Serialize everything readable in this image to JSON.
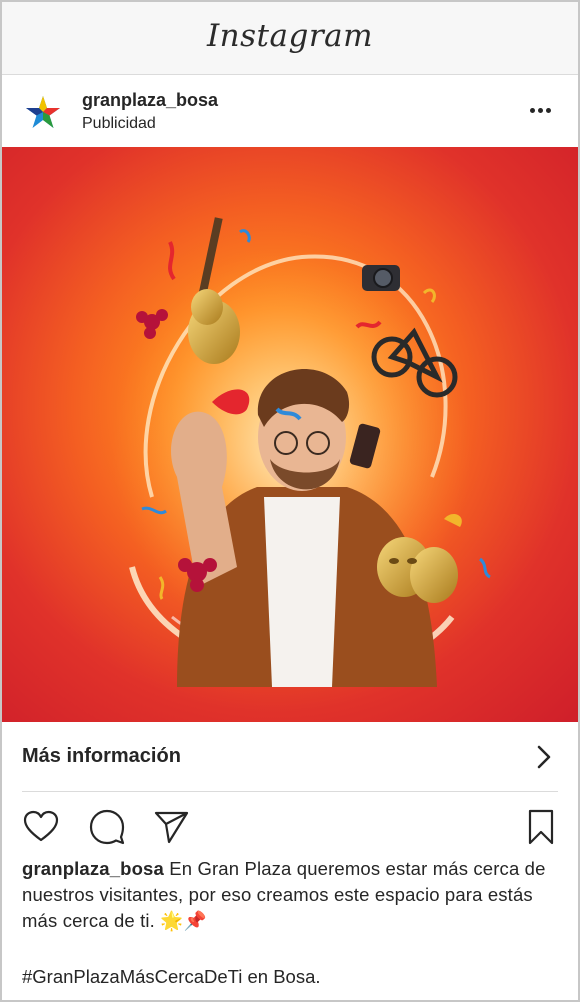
{
  "app": {
    "title": "Instagram"
  },
  "post": {
    "username": "granplaza_bosa",
    "sponsored_label": "Publicidad",
    "cta_label": "Más información",
    "caption_user": "granplaza_bosa",
    "caption_text": "En Gran Plaza queremos estar más cerca de nuestros visitantes, por eso creamos este espacio para estás más cerca de ti. 🌟📌",
    "hashtag_text": "#GranPlazaMásCercaDeTi en Bosa."
  },
  "icons": {
    "more": "more-horizontal-icon",
    "chevron": "chevron-right-icon",
    "like": "heart-icon",
    "comment": "comment-icon",
    "share": "paper-plane-icon",
    "save": "bookmark-icon"
  },
  "colors": {
    "bg_orange": "#ff8a1f",
    "bg_red": "#cf1f2a",
    "text": "#262626",
    "divider": "#dbdbdb"
  }
}
